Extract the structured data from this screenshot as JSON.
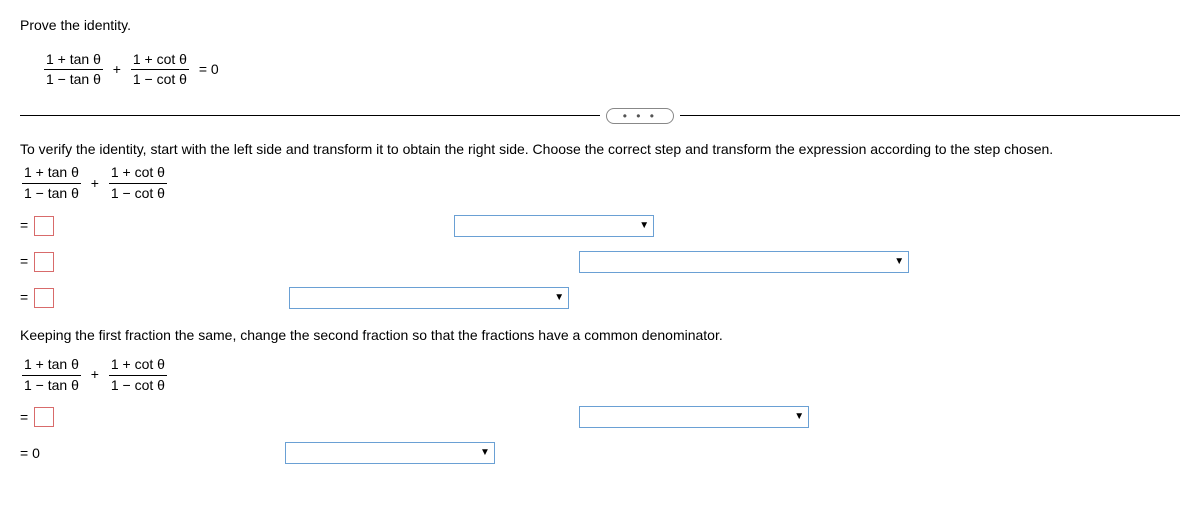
{
  "prompt": "Prove the identity.",
  "identity": {
    "f1num": "1 + tan θ",
    "f1den": "1 − tan θ",
    "plus": "+",
    "f2num": "1 + cot θ",
    "f2den": "1 − cot θ",
    "eq": "= 0"
  },
  "ellipsis": "• • •",
  "instruction": "To verify the identity, start with the left side and transform it to obtain the right side. Choose the correct step and transform the expression according to the step chosen.",
  "expr2": {
    "f1num": "1 + tan θ",
    "f1den": "1 − tan θ",
    "plus": "+",
    "f2num": "1 + cot θ",
    "f2den": "1 − cot θ"
  },
  "eq_symbol": "=",
  "hint": "Keeping the first fraction the same, change the second fraction so that the fractions have a common denominator.",
  "expr3": {
    "f1num": "1 + tan θ",
    "f1den": "1 − tan θ",
    "plus": "+",
    "f2num": "1 + cot θ",
    "f2den": "1 − cot θ"
  },
  "final": "= 0",
  "dropdown_arrow": "▼"
}
